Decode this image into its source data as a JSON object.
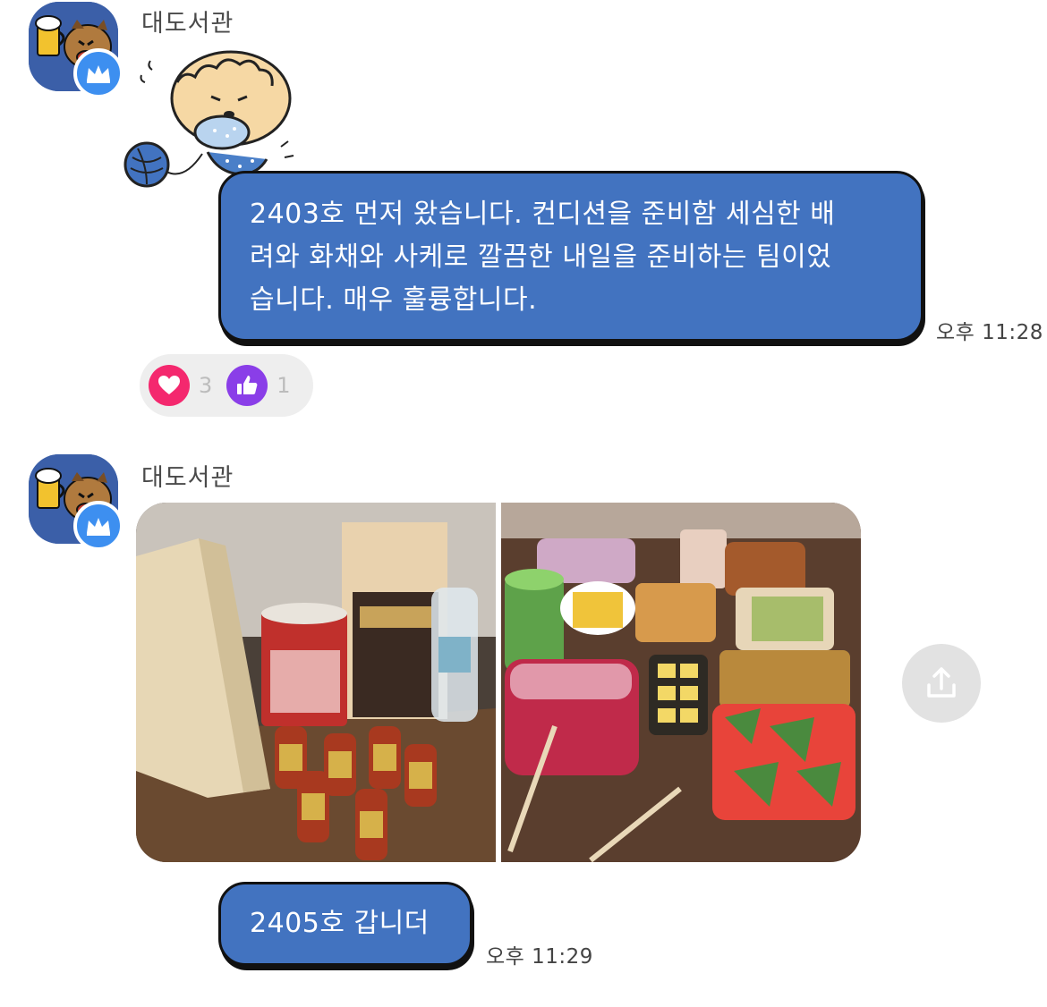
{
  "messages": [
    {
      "sender": "대도서관",
      "avatar": "beer-dog-avatar",
      "badge": "crown-icon",
      "sticker": "fluffy-dog-knitting-sticker",
      "text_lines": [
        "2403호 먼저 왔습니다. 컨디션을 준비함 세심한 배",
        "려와 화채와 사케로 깔끔한 내일을 준비하는 팀이었",
        "습니다. 매우 훌륭합니다."
      ],
      "time": "오후 11:28",
      "reactions": [
        {
          "icon": "heart-icon",
          "count": "3",
          "color": "#f4286e"
        },
        {
          "icon": "thumbs-up-icon",
          "count": "1",
          "color": "#8a3ee8"
        }
      ]
    },
    {
      "sender": "대도서관",
      "avatar": "beer-dog-avatar",
      "badge": "crown-icon",
      "photos": [
        "sake-and-drinks-photo",
        "snack-table-photo"
      ],
      "share": "share-icon",
      "text": "2405호 갑니더",
      "time": "오후 11:29"
    }
  ],
  "colors": {
    "bubble": "#4273c0",
    "avatar_bg": "#3b5fa8",
    "badge": "#3d8ff0"
  }
}
